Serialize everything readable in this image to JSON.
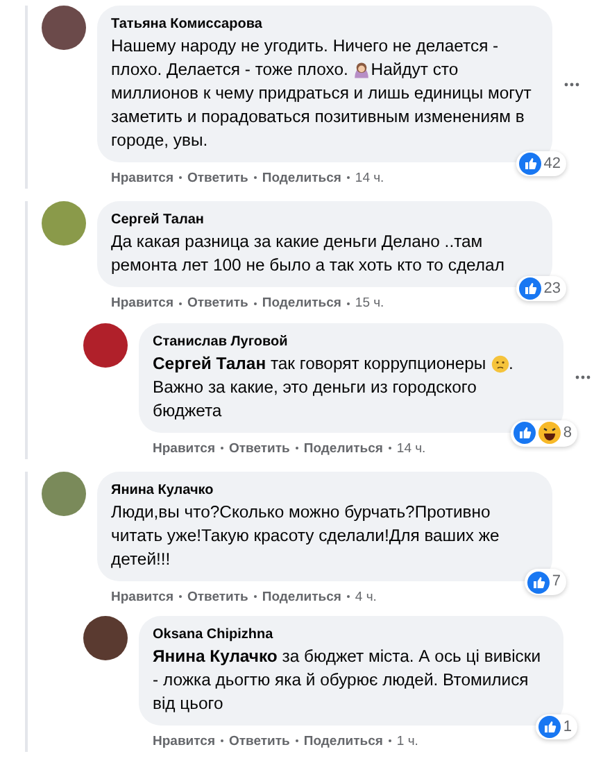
{
  "comments": [
    {
      "author": "Татьяна Комиссарова",
      "parts": [
        {
          "kind": "text",
          "text": "Нашему народу не угодить. Ничего не делается - плохо. Делается - тоже плохо. "
        },
        {
          "kind": "person-emoji"
        },
        {
          "kind": "text",
          "text": "Найдут сто миллионов к чему придраться и лишь единицы могут заметить и порадоваться позитивным изменениям в городе, увы."
        }
      ],
      "reactions": [
        {
          "kind": "like"
        }
      ],
      "reaction_count": "42",
      "menu": true,
      "actions": [
        "Нравится",
        "Ответить",
        "Поделиться"
      ],
      "time": "14 ч."
    },
    {
      "author": "Сергей Талан",
      "parts": [
        {
          "kind": "text",
          "text": "Да какая разница за какие деньги Делано ..там ремонта лет 100 не было а так хоть кто то сделал"
        }
      ],
      "reactions": [
        {
          "kind": "like"
        }
      ],
      "reaction_count": "23",
      "menu": false,
      "actions": [
        "Нравится",
        "Ответить",
        "Поделиться"
      ],
      "time": "15 ч.",
      "replies": [
        {
          "author": "Станислав Луговой",
          "parts": [
            {
              "kind": "text",
              "text": "**Сергей Талан** так говорят коррупционеры "
            },
            {
              "kind": "confused-emoji"
            },
            {
              "kind": "text",
              "text": ". Важно за какие, это деньги из городского бюджета"
            }
          ],
          "reactions": [
            {
              "kind": "like"
            },
            {
              "kind": "haha"
            }
          ],
          "reaction_count": "8",
          "menu": true,
          "actions": [
            "Нравится",
            "Ответить",
            "Поделиться"
          ],
          "time": "14 ч."
        }
      ]
    },
    {
      "author": "Янина Кулачко",
      "parts": [
        {
          "kind": "text",
          "text": "Люди,вы что?Сколько можно бурчать?Противно читать уже!Такую красоту сделали!Для ваших же детей!!!"
        }
      ],
      "reactions": [
        {
          "kind": "like"
        }
      ],
      "reaction_count": "7",
      "menu": false,
      "actions": [
        "Нравится",
        "Ответить",
        "Поделиться"
      ],
      "time": "4 ч.",
      "replies": [
        {
          "author": "Oksana Chipizhna",
          "parts": [
            {
              "kind": "text",
              "text": "**Янина Кулачко** за бюджет міста. А ось ці вивіски - ложка дьогтю яка й обурює людей. Втомилися від цього"
            }
          ],
          "reactions": [
            {
              "kind": "like"
            }
          ],
          "reaction_count": "1",
          "menu": false,
          "actions": [
            "Нравится",
            "Ответить",
            "Поделиться"
          ],
          "time": "1 ч."
        }
      ]
    }
  ]
}
